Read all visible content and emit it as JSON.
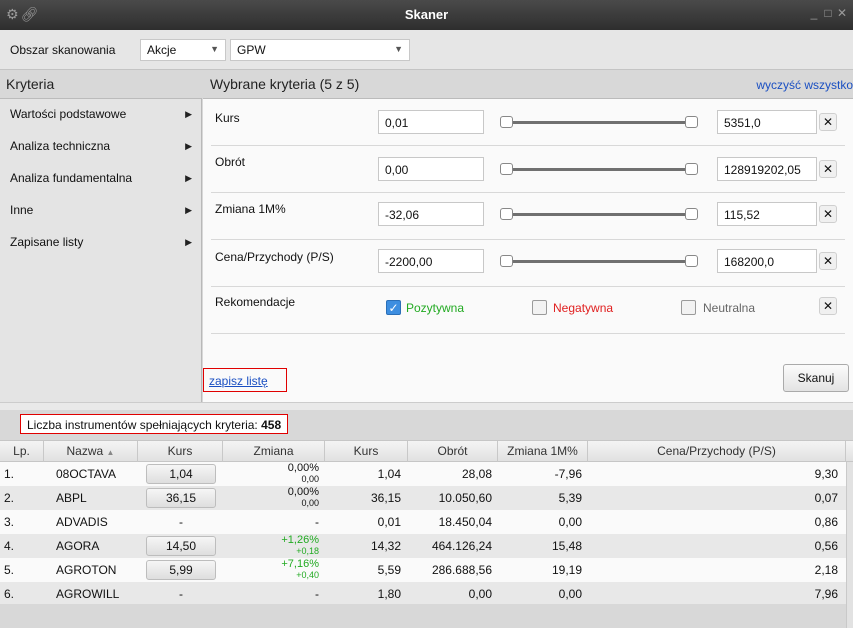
{
  "window": {
    "title": "Skaner"
  },
  "topbar": {
    "scan_area_label": "Obszar skanowania",
    "instrument_type": "Akcje",
    "market": "GPW"
  },
  "criteria_header": "Kryteria",
  "selected_header": "Wybrane kryteria (5 z 5)",
  "clear_all_label": "wyczyść wszystko",
  "menu": [
    {
      "label": "Wartości podstawowe"
    },
    {
      "label": "Analiza techniczna"
    },
    {
      "label": "Analiza fundamentalna"
    },
    {
      "label": "Inne"
    },
    {
      "label": "Zapisane listy"
    }
  ],
  "criteria": [
    {
      "label": "Kurs",
      "min": "0,01",
      "max": "5351,0"
    },
    {
      "label": "Obrót",
      "min": "0,00",
      "max": "128919202,05"
    },
    {
      "label": "Zmiana 1M%",
      "min": "-32,06",
      "max": "115,52"
    },
    {
      "label": "Cena/Przychody (P/S)",
      "min": "-2200,00",
      "max": "168200,0"
    }
  ],
  "recommendations": {
    "label": "Rekomendacje",
    "positive": "Pozytywna",
    "negative": "Negatywna",
    "neutral": "Neutralna",
    "positive_checked": true,
    "negative_checked": false,
    "neutral_checked": false
  },
  "save_list_label": "zapisz listę",
  "scan_button_label": "Skanuj",
  "count": {
    "label": "Liczba instrumentów spełniających kryteria:",
    "value": "458"
  },
  "table": {
    "headers": {
      "lp": "Lp.",
      "name": "Nazwa",
      "kurs": "Kurs",
      "zmiana": "Zmiana",
      "kurs2": "Kurs",
      "obrot": "Obrót",
      "zmiana1m": "Zmiana 1M%",
      "ps": "Cena/Przychody (P/S)"
    },
    "rows": [
      {
        "lp": "1.",
        "name": "08OCTAVA",
        "kurs": "1,04",
        "zmiana": "0,00%",
        "zmiana_abs": "0,00",
        "kurs2": "1,04",
        "obrot": "28,08",
        "zmiana1m": "-7,96",
        "ps": "9,30"
      },
      {
        "lp": "2.",
        "name": "ABPL",
        "kurs": "36,15",
        "zmiana": "0,00%",
        "zmiana_abs": "0,00",
        "kurs2": "36,15",
        "obrot": "10.050,60",
        "zmiana1m": "5,39",
        "ps": "0,07"
      },
      {
        "lp": "3.",
        "name": "ADVADIS",
        "kurs": "-",
        "zmiana": "-",
        "zmiana_abs": "",
        "kurs2": "0,01",
        "obrot": "18.450,04",
        "zmiana1m": "0,00",
        "ps": "0,86"
      },
      {
        "lp": "4.",
        "name": "AGORA",
        "kurs": "14,50",
        "zmiana": "+1,26%",
        "zmiana_abs": "+0,18",
        "kurs2": "14,32",
        "obrot": "464.126,24",
        "zmiana1m": "15,48",
        "ps": "0,56"
      },
      {
        "lp": "5.",
        "name": "AGROTON",
        "kurs": "5,99",
        "zmiana": "+7,16%",
        "zmiana_abs": "+0,40",
        "kurs2": "5,59",
        "obrot": "286.688,56",
        "zmiana1m": "19,19",
        "ps": "2,18"
      },
      {
        "lp": "6.",
        "name": "AGROWILL",
        "kurs": "-",
        "zmiana": "-",
        "zmiana_abs": "",
        "kurs2": "1,80",
        "obrot": "0,00",
        "zmiana1m": "0,00",
        "ps": "7,96"
      }
    ]
  },
  "colors": {
    "positive": "#22aa22",
    "negative": "#e02020",
    "link": "#1a4fc2",
    "highlight_border": "#e00000"
  }
}
